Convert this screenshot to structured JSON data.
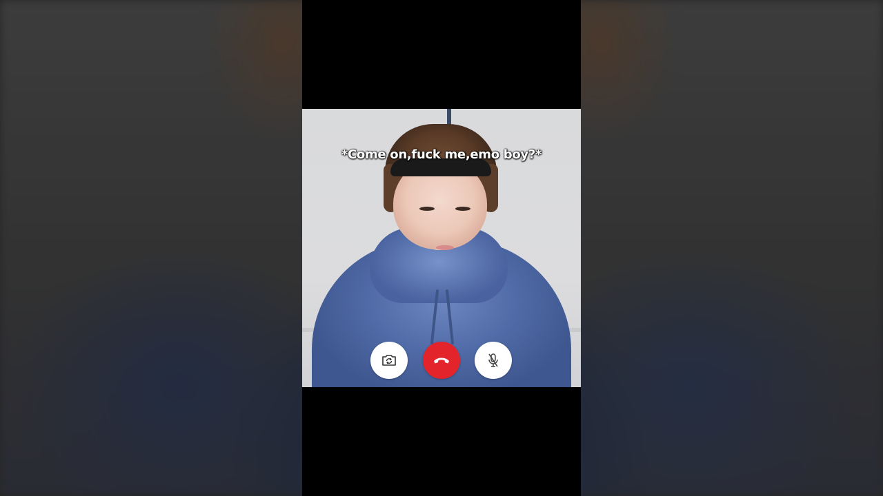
{
  "video": {
    "caption": "*Come on,fuck me,emo boy?*"
  },
  "controls": {
    "flip_camera": {
      "icon": "camera-flip-icon",
      "color": "#ffffff"
    },
    "end_call": {
      "icon": "phone-hangup-icon",
      "color": "#e3242b"
    },
    "mute": {
      "icon": "mic-off-icon",
      "color": "#ffffff"
    }
  }
}
